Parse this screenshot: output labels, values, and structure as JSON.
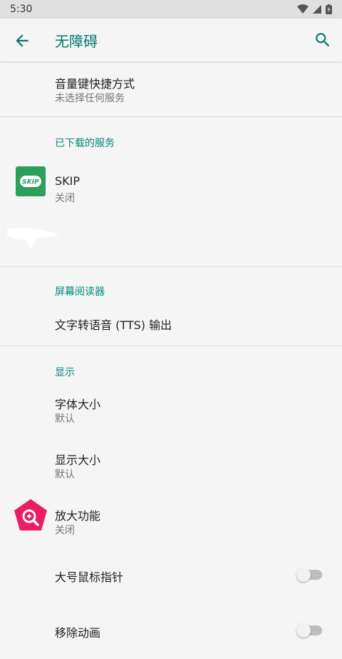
{
  "statusbar": {
    "time": "5:30"
  },
  "appbar": {
    "title": "无障碍"
  },
  "items": {
    "volume_shortcut": {
      "title": "音量键快捷方式",
      "subtitle": "未选择任何服务"
    },
    "section_downloaded": "已下载的服务",
    "skip": {
      "title": "SKIP",
      "subtitle": "关闭",
      "icon_label": "SKIP"
    },
    "section_screen_reader": "屏幕阅读器",
    "tts": {
      "title": "文字转语音 (TTS) 输出"
    },
    "section_display": "显示",
    "font_size": {
      "title": "字体大小",
      "subtitle": "默认"
    },
    "display_size": {
      "title": "显示大小",
      "subtitle": "默认"
    },
    "magnification": {
      "title": "放大功能",
      "subtitle": "关闭"
    },
    "large_pointer": {
      "title": "大号鼠标指针",
      "enabled": false
    },
    "remove_animations": {
      "title": "移除动画",
      "enabled": false
    }
  },
  "colors": {
    "accent": "#00897b",
    "skip_green": "#2e9e5b",
    "magnify_pink": "#e91e63"
  }
}
